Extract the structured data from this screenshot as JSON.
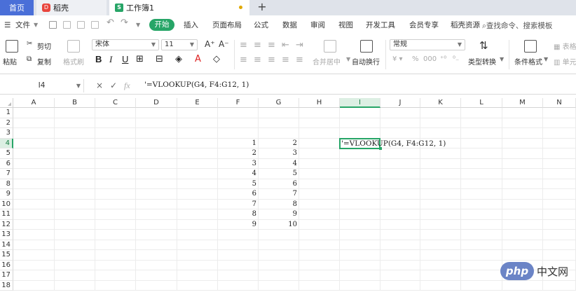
{
  "tabs": {
    "home": "首页",
    "daoke": "稻壳",
    "workbook": "工作簿1",
    "add": "+"
  },
  "menu": {
    "file": "文件",
    "items": [
      "开始",
      "插入",
      "页面布局",
      "公式",
      "数据",
      "审阅",
      "视图",
      "开发工具",
      "会员专享",
      "稻壳资源"
    ],
    "search": "查找命令、搜索模板"
  },
  "ribbon": {
    "paste": "粘贴",
    "cut": "剪切",
    "copy": "复制",
    "format_painter": "格式刷",
    "font_name": "宋体",
    "font_size": "11",
    "grow": "A⁺",
    "shrink": "A⁻",
    "bold": "B",
    "italic": "I",
    "underline": "U",
    "merge": "合并居中",
    "wrap": "自动换行",
    "number_format": "常规",
    "type_convert": "类型转换",
    "cond_format": "条件格式",
    "table_style": "表格",
    "cell": "单元"
  },
  "formula_bar": {
    "name_box": "I4",
    "cancel": "×",
    "confirm": "✓",
    "fx": "fx",
    "content": "'=VLOOKUP(G4, F4:G12, 1)"
  },
  "grid": {
    "columns": [
      "A",
      "B",
      "C",
      "D",
      "E",
      "F",
      "G",
      "H",
      "I",
      "J",
      "K",
      "L",
      "M",
      "N"
    ],
    "rows": [
      "1",
      "2",
      "3",
      "4",
      "5",
      "6",
      "7",
      "8",
      "9",
      "10",
      "11",
      "12",
      "13",
      "14",
      "15",
      "16",
      "17",
      "18"
    ],
    "active_col": "I",
    "active_row": "4",
    "col_f": [
      "1",
      "2",
      "3",
      "4",
      "5",
      "6",
      "7",
      "8",
      "9"
    ],
    "col_g": [
      "2",
      "3",
      "4",
      "5",
      "6",
      "7",
      "8",
      "9",
      "10"
    ],
    "active_cell_text": "'=VLOOKUP(G4, F4:G12, 1)"
  },
  "watermark": {
    "logo": "php",
    "text": "中文网"
  }
}
